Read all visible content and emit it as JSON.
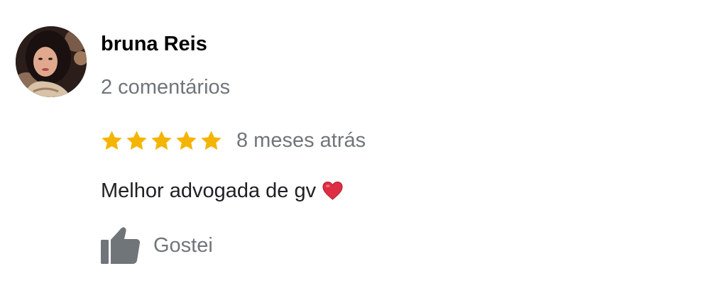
{
  "review": {
    "author": {
      "name": "bruna Reis",
      "review_count": "2 comentários",
      "avatar": "profile-photo"
    },
    "rating": {
      "value": 5,
      "max": 5,
      "star_color": "#f4b400",
      "star_icon": "star-icon"
    },
    "time_ago": "8 meses atrás",
    "text": "Melhor advogada de gv",
    "text_emoji": "heart-icon",
    "like_button": {
      "label": "Gostei",
      "icon": "thumbs-up-icon",
      "color": "#70757a"
    }
  }
}
